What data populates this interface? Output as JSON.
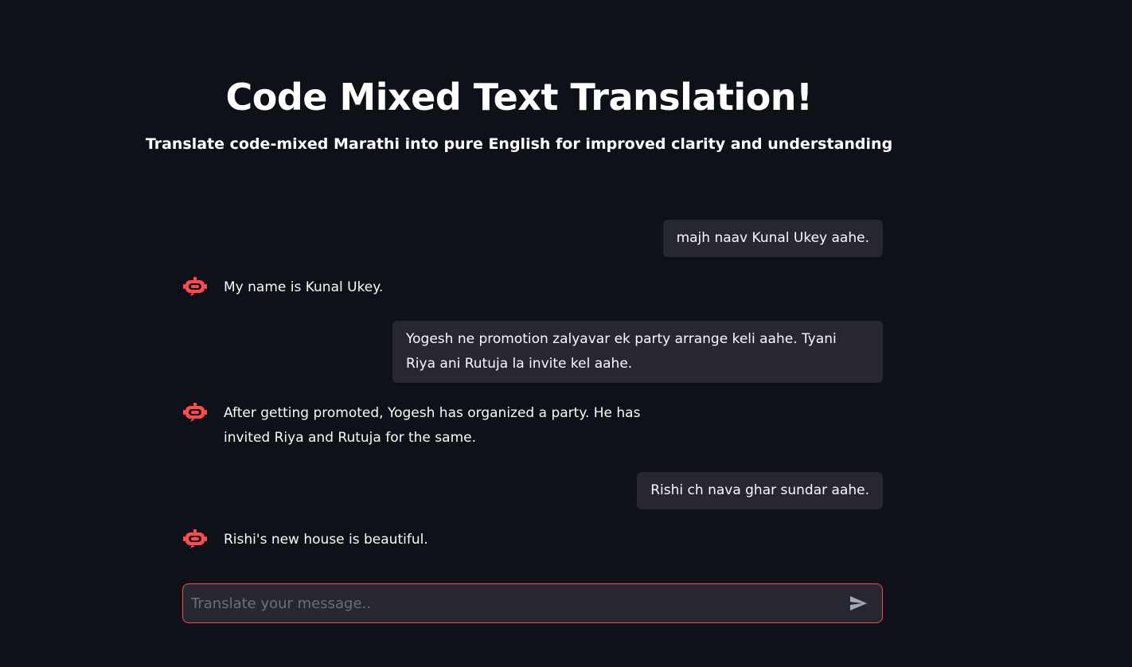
{
  "header": {
    "title": "Code Mixed Text Translation!",
    "subtitle": "Translate code-mixed Marathi into pure English for improved clarity and understanding"
  },
  "messages": [
    {
      "role": "user",
      "text": "majh naav Kunal Ukey aahe."
    },
    {
      "role": "assistant",
      "avatar_icon": "robot-icon",
      "text": "My name is Kunal Ukey."
    },
    {
      "role": "user",
      "text": "Yogesh ne promotion zalyavar ek party arrange keli aahe. Tyani Riya ani Rutuja la invite kel aahe."
    },
    {
      "role": "assistant",
      "avatar_icon": "robot-icon",
      "text": "After getting promoted, Yogesh has organized a party. He has invited Riya and Rutuja for the same."
    },
    {
      "role": "user",
      "text": "Rishi ch nava ghar sundar aahe."
    },
    {
      "role": "assistant",
      "avatar_icon": "robot-icon",
      "text": "Rishi's new house is beautiful."
    }
  ],
  "chat_input": {
    "placeholder": "Translate your message..",
    "value": "",
    "send_icon": "send-icon"
  },
  "colors": {
    "background": "#0e1117",
    "bubble": "#262730",
    "accent": "#ff4b4b",
    "text": "#fafafa"
  }
}
